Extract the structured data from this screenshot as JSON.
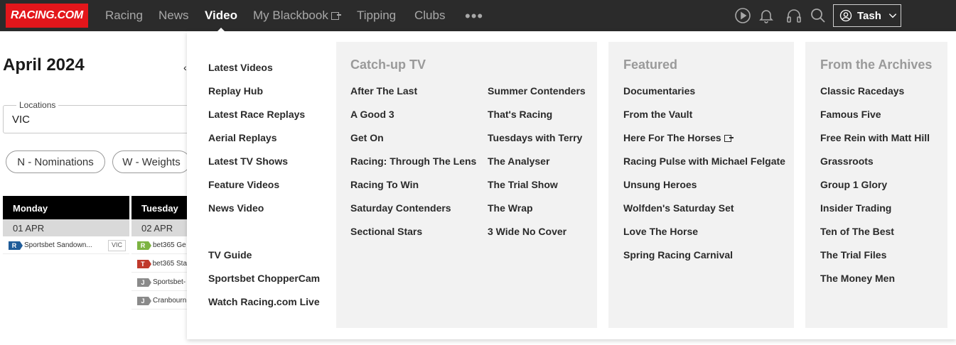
{
  "brand": {
    "logo_text": "RACING.COM",
    "accent": "#e3161b",
    "nav_bg": "#2b2b2b"
  },
  "nav": {
    "items": [
      {
        "label": "Racing"
      },
      {
        "label": "News"
      },
      {
        "label": "Video"
      },
      {
        "label": "My Blackbook"
      },
      {
        "label": "Tipping"
      },
      {
        "label": "Clubs"
      }
    ],
    "active": "Video",
    "more": "•••",
    "icons": [
      "play-circle-icon",
      "bell-icon",
      "headphones-icon",
      "search-icon"
    ],
    "user_name": "Tash"
  },
  "page": {
    "title": "April 2024",
    "prev_arrow": "‹",
    "location_label": "Locations",
    "location_value": "VIC",
    "filters": [
      "N - Nominations",
      "W - Weights"
    ],
    "days": [
      {
        "name": "Monday",
        "date": "01 APR"
      },
      {
        "name": "Tuesday",
        "date": "02 APR"
      }
    ],
    "monday_meetings": [
      {
        "type": "R",
        "color": "#1f5c99",
        "name": "Sportsbet Sandown...",
        "state": "VIC"
      }
    ],
    "tuesday_meetings": [
      {
        "type": "R",
        "color": "#7cb342",
        "name": "bet365 Ge"
      },
      {
        "type": "T",
        "color": "#c0392b",
        "name": "bet365 Sta"
      },
      {
        "type": "J",
        "color": "#8a8a8a",
        "name": "Sportsbet-"
      },
      {
        "type": "J",
        "color": "#8a8a8a",
        "name": "Cranbourn"
      }
    ]
  },
  "menu": {
    "main_links": [
      "Latest Videos",
      "Replay Hub",
      "Latest Race Replays",
      "Aerial Replays",
      "Latest TV Shows",
      "Feature Videos",
      "News Video"
    ],
    "secondary_links": [
      "TV Guide",
      "Sportsbet ChopperCam",
      "Watch Racing.com Live"
    ],
    "catchup": {
      "title": "Catch-up TV",
      "col1": [
        "After The Last",
        "A Good 3",
        "Get On",
        "Racing: Through The Lens",
        "Racing To Win",
        "Saturday Contenders",
        "Sectional Stars"
      ],
      "col2": [
        "Summer Contenders",
        "That's Racing",
        "Tuesdays with Terry",
        "The Analyser",
        "The Trial Show",
        "The Wrap",
        "3 Wide No Cover"
      ]
    },
    "featured": {
      "title": "Featured",
      "links": [
        "Documentaries",
        "From the Vault",
        "Here For The Horses",
        "Racing Pulse with Michael Felgate",
        "Unsung Heroes",
        "Wolfden's Saturday Set",
        "Love The Horse",
        "Spring Racing Carnival"
      ]
    },
    "archives": {
      "title": "From the Archives",
      "links": [
        "Classic Racedays",
        "Famous Five",
        "Free Rein with Matt Hill",
        "Grassroots",
        "Group 1 Glory",
        "Insider Trading",
        "Ten of The Best",
        "The Trial Files",
        "The Money Men"
      ]
    }
  }
}
